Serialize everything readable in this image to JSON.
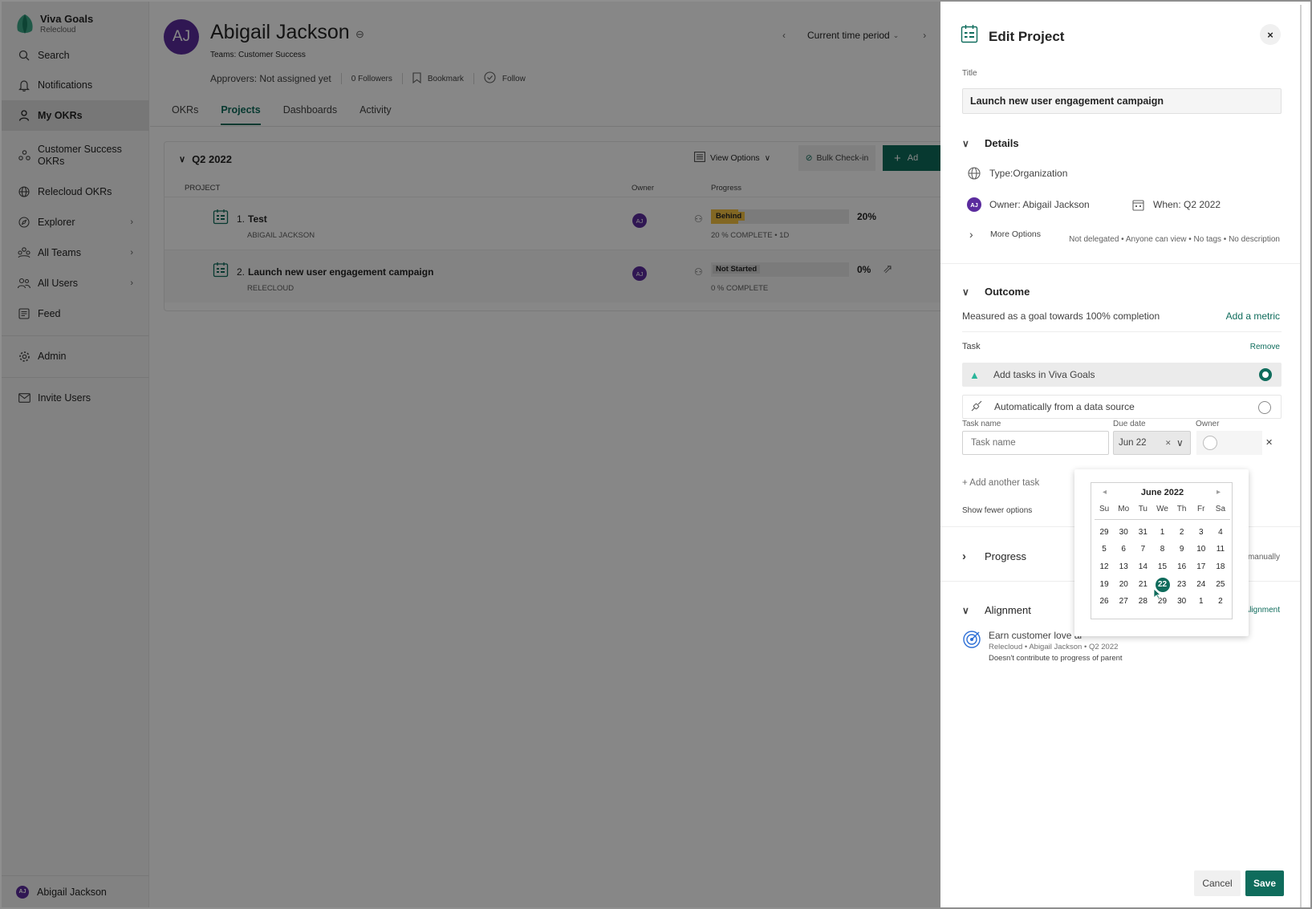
{
  "sidebar": {
    "brand": "Viva Goals",
    "tenant": "Relecloud",
    "items": [
      {
        "label": "Search",
        "icon": "search-icon"
      },
      {
        "label": "Notifications",
        "icon": "bell-icon"
      },
      {
        "label": "My OKRs",
        "icon": "person-icon"
      },
      {
        "label": "Customer Success OKRs",
        "icon": "team-icon"
      },
      {
        "label": "Relecloud OKRs",
        "icon": "globe-icon"
      },
      {
        "label": "Explorer",
        "icon": "compass-icon"
      },
      {
        "label": "All Teams",
        "icon": "teams-icon"
      },
      {
        "label": "All Users",
        "icon": "users-icon"
      },
      {
        "label": "Feed",
        "icon": "feed-icon"
      },
      {
        "label": "Admin",
        "icon": "gear-icon"
      },
      {
        "label": "Invite Users",
        "icon": "mail-icon"
      }
    ],
    "user": {
      "initials": "AJ",
      "name": "Abigail Jackson"
    }
  },
  "header": {
    "initials": "AJ",
    "name": "Abigail Jackson",
    "teams": "Teams: Customer Success",
    "approvers": "Approvers: Not assigned yet",
    "followers": "0 Followers",
    "bookmark": "Bookmark",
    "follow": "Follow",
    "period": "Current time period"
  },
  "tabs": [
    "OKRs",
    "Projects",
    "Dashboards",
    "Activity"
  ],
  "projects": {
    "period_title": "Q2 2022",
    "view_options": "View Options",
    "bulk_checkin": "Bulk Check-in",
    "add_label": "Ad",
    "columns": {
      "project": "PROJECT",
      "owner": "Owner",
      "progress": "Progress"
    },
    "rows": [
      {
        "num": "1.",
        "title": "Test",
        "sub": "ABIGAIL JACKSON",
        "owner": "AJ",
        "status": "Behind",
        "status_color": "#f6c343",
        "progress": 0.2,
        "pct": "20%",
        "complete": "20 % COMPLETE • 1D"
      },
      {
        "num": "2.",
        "title": "Launch new user engagement campaign",
        "sub": "RELECLOUD",
        "owner": "AJ",
        "status": "Not Started",
        "status_color": "#d6d6d6",
        "progress": 0,
        "pct": "0%",
        "complete": "0 % COMPLETE"
      }
    ]
  },
  "panel": {
    "title": "Edit Project",
    "title_label": "Title",
    "title_value": "Launch new user engagement campaign",
    "details": "Details",
    "type": "Type:Organization",
    "owner_initials": "AJ",
    "owner": "Owner: Abigail Jackson",
    "when": "When: Q2 2022",
    "more_options": "More Options",
    "more_meta": "Not delegated • Anyone can view • No tags • No description",
    "outcome": "Outcome",
    "measured": "Measured as a goal towards 100% completion",
    "add_metric": "Add a metric",
    "task": "Task",
    "remove": "Remove",
    "opt1": "Add tasks in Viva Goals",
    "opt2": "Automatically from a data source",
    "col_task": "Task name",
    "col_due": "Due date",
    "col_owner": "Owner",
    "task_placeholder": "Task name",
    "due_value": "Jun 22",
    "add_another": "+ Add another task",
    "show_fewer": "Show fewer options",
    "progress": "Progress",
    "progress_right": "d manually",
    "alignment": "Alignment",
    "alignment_link": "Alignment",
    "align_title": "Earn customer love ar",
    "align_meta": "Relecloud • Abigail Jackson • Q2 2022",
    "align_note": "Doesn't contribute to progress of parent",
    "cancel": "Cancel",
    "save": "Save"
  },
  "calendar": {
    "month": "June 2022",
    "dow": [
      "Su",
      "Mo",
      "Tu",
      "We",
      "Th",
      "Fr",
      "Sa"
    ],
    "weeks": [
      [
        "29",
        "30",
        "31",
        "1",
        "2",
        "3",
        "4"
      ],
      [
        "5",
        "6",
        "7",
        "8",
        "9",
        "10",
        "11"
      ],
      [
        "12",
        "13",
        "14",
        "15",
        "16",
        "17",
        "18"
      ],
      [
        "19",
        "20",
        "21",
        "22",
        "23",
        "24",
        "25"
      ],
      [
        "26",
        "27",
        "28",
        "29",
        "30",
        "1",
        "2"
      ]
    ],
    "selected": "22"
  },
  "colors": {
    "accent": "#0f6c5c",
    "avatar": "#5b2c9e",
    "behind": "#f6c343"
  }
}
